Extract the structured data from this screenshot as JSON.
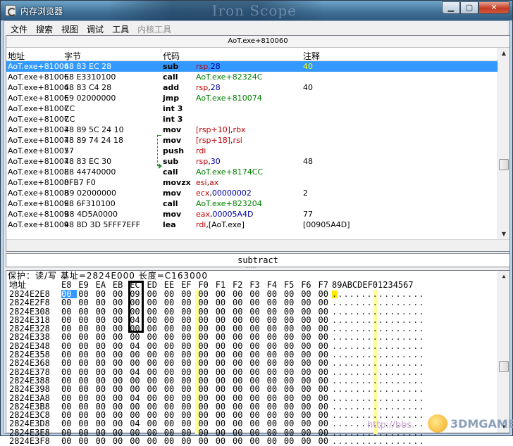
{
  "window": {
    "title": "内存浏览器",
    "title_decor_text": "Iron Scope",
    "buttons": {
      "minimize": "▁",
      "maximize": "▢",
      "close": "✕"
    }
  },
  "menu": {
    "items": [
      {
        "label": "文件",
        "disabled": false
      },
      {
        "label": "搜索",
        "disabled": false
      },
      {
        "label": "视图",
        "disabled": false
      },
      {
        "label": "调试",
        "disabled": false
      },
      {
        "label": "工具",
        "disabled": false
      },
      {
        "label": "内核工具",
        "disabled": true
      }
    ]
  },
  "disassembler": {
    "header_address": "AoT.exe+810060",
    "columns": {
      "address": "地址",
      "bytes": "字节",
      "opcode": "代码",
      "comment": "注释"
    },
    "rows": [
      {
        "addr": "AoT.exe+81006",
        "bytes": "48 83 EC 28",
        "op": "sub",
        "args": [
          [
            "reg",
            "rsp"
          ],
          [
            "plain",
            ","
          ],
          [
            "num",
            "28"
          ]
        ],
        "cmt": "40",
        "selected": true
      },
      {
        "addr": "AoT.exe+81006",
        "bytes": "E8 E3310100",
        "op": "call",
        "args": [
          [
            "sym",
            "AoT.exe+82324C"
          ]
        ],
        "cmt": ""
      },
      {
        "addr": "AoT.exe+81006",
        "bytes": "48 83 C4 28",
        "op": "add",
        "args": [
          [
            "reg",
            "rsp"
          ],
          [
            "plain",
            ","
          ],
          [
            "num",
            "28"
          ]
        ],
        "cmt": "40"
      },
      {
        "addr": "AoT.exe+81006",
        "bytes": "E9 02000000",
        "op": "jmp",
        "args": [
          [
            "sym",
            "AoT.exe+810074"
          ]
        ],
        "cmt": ""
      },
      {
        "addr": "AoT.exe+81007",
        "bytes": "CC",
        "op": "int 3",
        "args": [],
        "cmt": ""
      },
      {
        "addr": "AoT.exe+81007",
        "bytes": "CC",
        "op": "int 3",
        "args": [],
        "cmt": ""
      },
      {
        "addr": "AoT.exe+81007",
        "bytes": "48 89 5C 24 10",
        "op": "mov",
        "args": [
          [
            "reg",
            "[rsp+10]"
          ],
          [
            "plain",
            ","
          ],
          [
            "reg",
            "rbx"
          ]
        ],
        "cmt": ""
      },
      {
        "addr": "AoT.exe+81007",
        "bytes": "48 89 74 24 18",
        "op": "mov",
        "args": [
          [
            "reg",
            "[rsp+18]"
          ],
          [
            "plain",
            ","
          ],
          [
            "reg",
            "rsi"
          ]
        ],
        "cmt": ""
      },
      {
        "addr": "AoT.exe+81007",
        "bytes": "57",
        "op": "push",
        "args": [
          [
            "reg",
            "rdi"
          ]
        ],
        "cmt": ""
      },
      {
        "addr": "AoT.exe+81007",
        "bytes": "48 83 EC 30",
        "op": "sub",
        "args": [
          [
            "reg",
            "rsp"
          ],
          [
            "plain",
            ","
          ],
          [
            "num",
            "30"
          ]
        ],
        "cmt": "48"
      },
      {
        "addr": "AoT.exe+81008",
        "bytes": "E8 44740000",
        "op": "call",
        "args": [
          [
            "sym",
            "AoT.exe+8174CC"
          ]
        ],
        "cmt": ""
      },
      {
        "addr": "AoT.exe+81008",
        "bytes": "0FB7 F0",
        "op": "movzx",
        "args": [
          [
            "reg",
            "esi"
          ],
          [
            "plain",
            ","
          ],
          [
            "reg",
            "ax"
          ]
        ],
        "cmt": ""
      },
      {
        "addr": "AoT.exe+81008",
        "bytes": "B9 02000000",
        "op": "mov",
        "args": [
          [
            "reg",
            "ecx"
          ],
          [
            "plain",
            ","
          ],
          [
            "num",
            "00000002"
          ]
        ],
        "cmt": "2"
      },
      {
        "addr": "AoT.exe+81009",
        "bytes": "E8 6F310100",
        "op": "call",
        "args": [
          [
            "sym",
            "AoT.exe+823204"
          ]
        ],
        "cmt": ""
      },
      {
        "addr": "AoT.exe+81009",
        "bytes": "B8 4D5A0000",
        "op": "mov",
        "args": [
          [
            "reg",
            "eax"
          ],
          [
            "plain",
            ","
          ],
          [
            "num",
            "00005A4D"
          ]
        ],
        "cmt": "77"
      },
      {
        "addr": "AoT.exe+81009",
        "bytes": "48 8D 3D 5FFF7EFF",
        "op": "lea",
        "args": [
          [
            "reg",
            "rdi"
          ],
          [
            "plain",
            ","
          ],
          [
            "plain",
            "[AoT.exe]"
          ]
        ],
        "cmt": "[00905A4D]"
      }
    ]
  },
  "info_bar": {
    "text": "subtract"
  },
  "hex": {
    "status": "保护：读/写   基址=2824E000  长度=C163000",
    "header_addr": "地址",
    "header_cols": [
      "E8",
      "E9",
      "EA",
      "EB",
      "EC",
      "ED",
      "EE",
      "EF",
      "F0",
      "F1",
      "F2",
      "F3",
      "F4",
      "F5",
      "F6",
      "F7"
    ],
    "header_ascii": "89ABCDEF01234567",
    "rows": [
      {
        "addr": "2824E2E8",
        "bytes": [
          "00",
          "00",
          "00",
          "00",
          "09",
          "00",
          "00",
          "00",
          "00",
          "00",
          "00",
          "00",
          "00",
          "00",
          "00",
          "00"
        ]
      },
      {
        "addr": "2824E2F8",
        "bytes": [
          "00",
          "00",
          "00",
          "00",
          "00",
          "00",
          "00",
          "00",
          "00",
          "00",
          "00",
          "00",
          "00",
          "00",
          "00",
          "00"
        ]
      },
      {
        "addr": "2824E308",
        "bytes": [
          "00",
          "00",
          "00",
          "00",
          "00",
          "00",
          "00",
          "00",
          "00",
          "00",
          "00",
          "00",
          "00",
          "00",
          "00",
          "00"
        ]
      },
      {
        "addr": "2824E318",
        "bytes": [
          "00",
          "00",
          "00",
          "00",
          "04",
          "00",
          "00",
          "00",
          "00",
          "00",
          "00",
          "00",
          "00",
          "00",
          "00",
          "00"
        ]
      },
      {
        "addr": "2824E328",
        "bytes": [
          "00",
          "00",
          "00",
          "00",
          "00",
          "00",
          "00",
          "00",
          "00",
          "00",
          "00",
          "00",
          "00",
          "00",
          "00",
          "00"
        ]
      },
      {
        "addr": "2824E338",
        "bytes": [
          "00",
          "00",
          "00",
          "00",
          "00",
          "00",
          "00",
          "00",
          "00",
          "00",
          "00",
          "00",
          "00",
          "00",
          "00",
          "00"
        ]
      },
      {
        "addr": "2824E348",
        "bytes": [
          "00",
          "00",
          "00",
          "00",
          "04",
          "00",
          "00",
          "00",
          "00",
          "00",
          "00",
          "00",
          "00",
          "00",
          "00",
          "00"
        ]
      },
      {
        "addr": "2824E358",
        "bytes": [
          "00",
          "00",
          "00",
          "00",
          "00",
          "00",
          "00",
          "00",
          "00",
          "00",
          "00",
          "00",
          "00",
          "00",
          "00",
          "00"
        ]
      },
      {
        "addr": "2824E368",
        "bytes": [
          "00",
          "00",
          "00",
          "00",
          "00",
          "00",
          "00",
          "00",
          "00",
          "00",
          "00",
          "00",
          "00",
          "00",
          "00",
          "00"
        ]
      },
      {
        "addr": "2824E378",
        "bytes": [
          "00",
          "00",
          "00",
          "00",
          "04",
          "00",
          "00",
          "00",
          "00",
          "00",
          "00",
          "00",
          "00",
          "00",
          "00",
          "00"
        ]
      },
      {
        "addr": "2824E388",
        "bytes": [
          "00",
          "00",
          "00",
          "00",
          "00",
          "00",
          "00",
          "00",
          "00",
          "00",
          "00",
          "00",
          "00",
          "00",
          "00",
          "00"
        ]
      },
      {
        "addr": "2824E398",
        "bytes": [
          "00",
          "00",
          "00",
          "00",
          "00",
          "00",
          "00",
          "00",
          "00",
          "00",
          "00",
          "00",
          "00",
          "00",
          "00",
          "00"
        ]
      },
      {
        "addr": "2824E3A8",
        "bytes": [
          "00",
          "00",
          "00",
          "00",
          "04",
          "00",
          "00",
          "00",
          "00",
          "00",
          "00",
          "00",
          "00",
          "00",
          "00",
          "00"
        ]
      },
      {
        "addr": "2824E3B8",
        "bytes": [
          "00",
          "00",
          "00",
          "00",
          "00",
          "00",
          "00",
          "00",
          "00",
          "00",
          "00",
          "00",
          "00",
          "00",
          "00",
          "00"
        ]
      },
      {
        "addr": "2824E3C8",
        "bytes": [
          "00",
          "00",
          "00",
          "00",
          "00",
          "00",
          "00",
          "00",
          "00",
          "00",
          "00",
          "00",
          "00",
          "00",
          "00",
          "00"
        ]
      },
      {
        "addr": "2824E3D8",
        "bytes": [
          "00",
          "00",
          "00",
          "00",
          "04",
          "00",
          "00",
          "00",
          "00",
          "00",
          "00",
          "00",
          "00",
          "00",
          "00",
          "00"
        ]
      },
      {
        "addr": "2824E3E8",
        "bytes": [
          "00",
          "00",
          "00",
          "00",
          "00",
          "00",
          "00",
          "00",
          "00",
          "00",
          "00",
          "00",
          "00",
          "00",
          "00",
          "00"
        ]
      },
      {
        "addr": "2824E3F8",
        "bytes": [
          "00",
          "00",
          "00",
          "00",
          "00",
          "00",
          "00",
          "00",
          "00",
          "00",
          "00",
          "00",
          "00",
          "00",
          "00",
          "00"
        ]
      }
    ],
    "ascii_placeholder": "................"
  },
  "watermark": {
    "url": "http://bbs.",
    "brand": "3DMGAME"
  },
  "colors": {
    "selection": "#3399ff",
    "register": "#c00000",
    "symbol": "#008000",
    "number": "#0000a0",
    "highlight_col": "#ffff9a"
  }
}
